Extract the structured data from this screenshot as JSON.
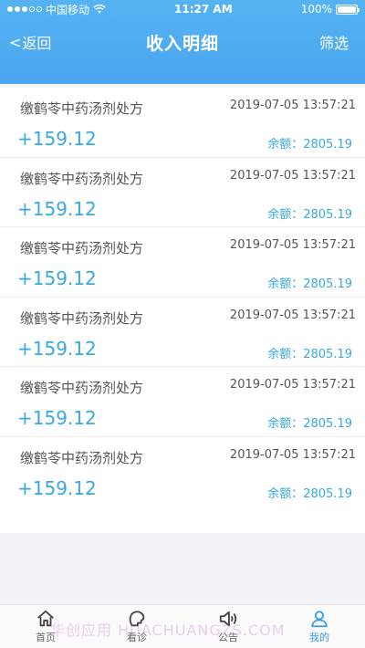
{
  "status_bar": {
    "carrier": "中国移动",
    "time": "11:27 AM",
    "battery": "100%"
  },
  "nav": {
    "back_label": "返回",
    "title": "收入明细",
    "filter_label": "筛选"
  },
  "records": [
    {
      "title": "缴鹤苓中药汤剂处方",
      "time": "2019-07-05 13:57:21",
      "amount": "+159.12",
      "balance": "余额：2805.19"
    },
    {
      "title": "缴鹤苓中药汤剂处方",
      "time": "2019-07-05 13:57:21",
      "amount": "+159.12",
      "balance": "余额：2805.19"
    },
    {
      "title": "缴鹤苓中药汤剂处方",
      "time": "2019-07-05 13:57:21",
      "amount": "+159.12",
      "balance": "余额：2805.19"
    },
    {
      "title": "缴鹤苓中药汤剂处方",
      "time": "2019-07-05 13:57:21",
      "amount": "+159.12",
      "balance": "余额：2805.19"
    },
    {
      "title": "缴鹤苓中药汤剂处方",
      "time": "2019-07-05 13:57:21",
      "amount": "+159.12",
      "balance": "余额：2805.19"
    },
    {
      "title": "缴鹤苓中药汤剂处方",
      "time": "2019-07-05 13:57:21",
      "amount": "+159.12",
      "balance": "余额：2805.19"
    }
  ],
  "tabbar": {
    "items": [
      {
        "label": "首页",
        "icon": "home-icon"
      },
      {
        "label": "看诊",
        "icon": "consult-icon"
      },
      {
        "label": "公告",
        "icon": "speaker-icon"
      },
      {
        "label": "我的",
        "icon": "user-icon",
        "active": true
      }
    ]
  },
  "watermark": "华创应用 HUACHUANGZS.COM",
  "colors": {
    "header": "#4aa6ef",
    "accent": "#37a9e0",
    "tab_active": "#3a9ce6"
  }
}
